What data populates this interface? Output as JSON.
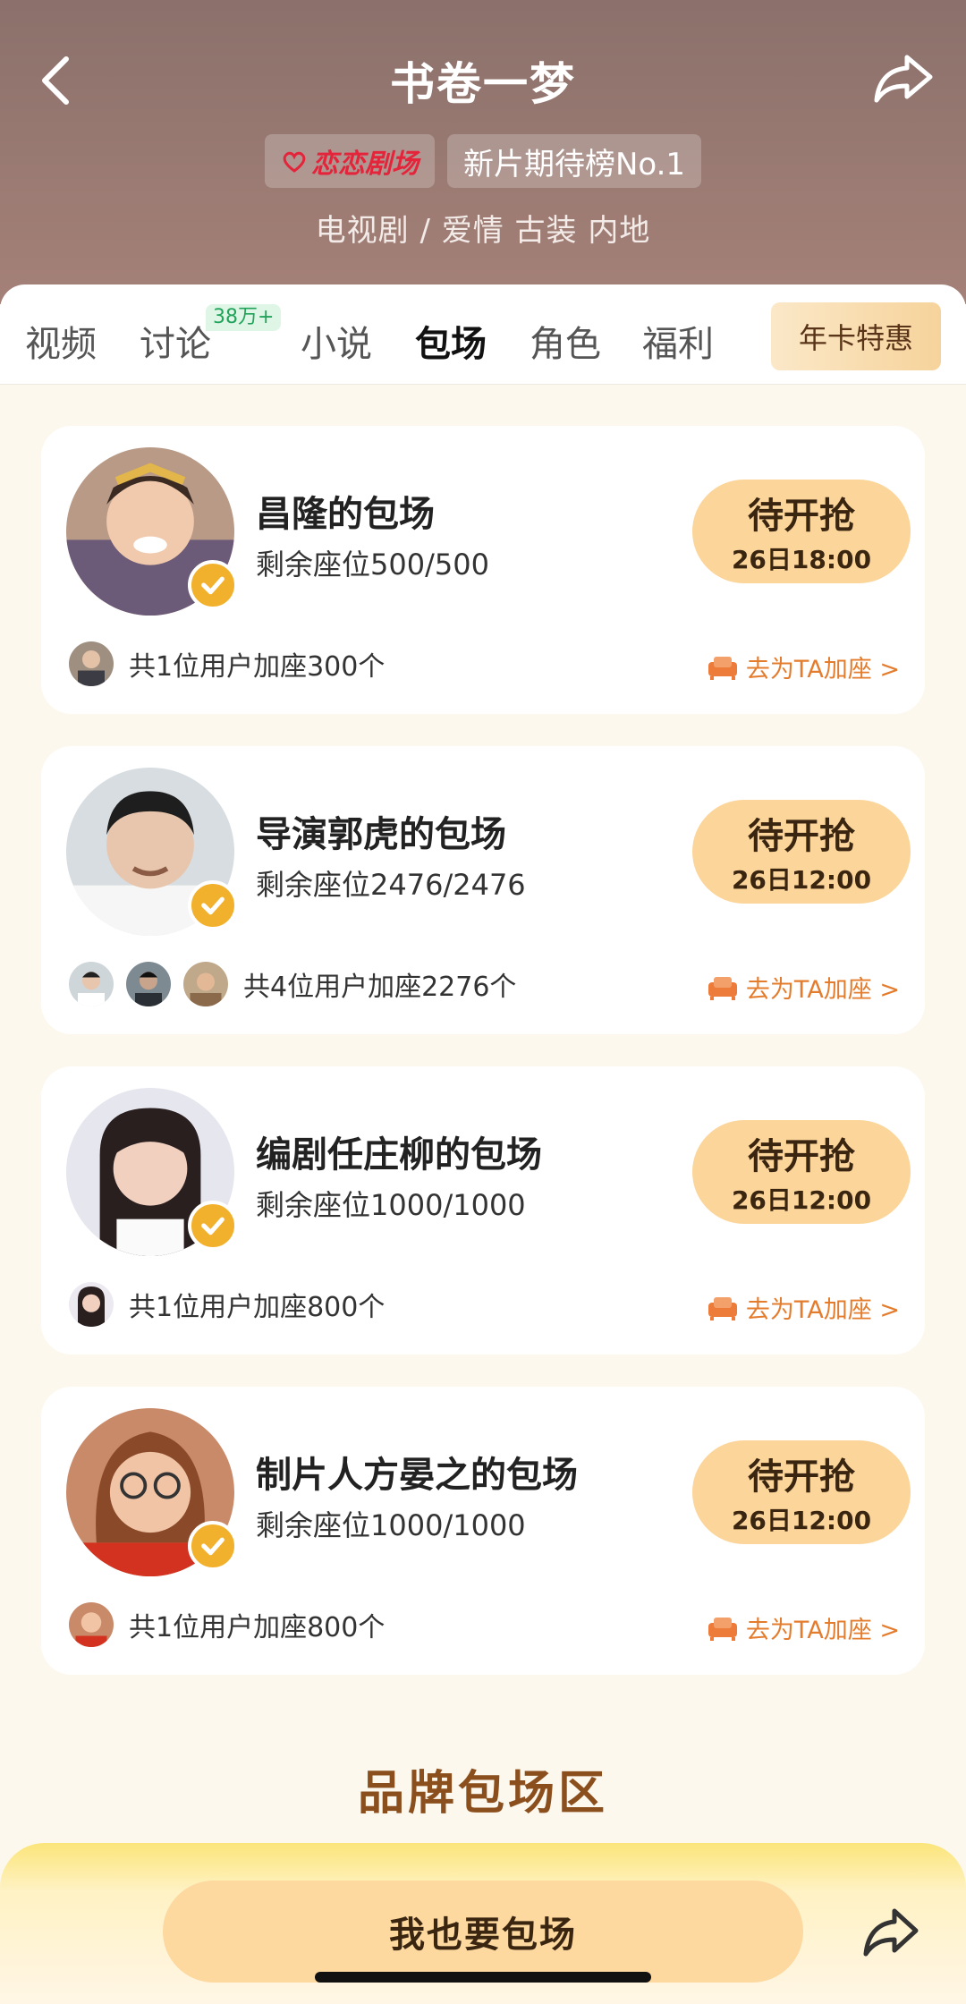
{
  "header": {
    "title": "书卷一梦",
    "brand_badge": "恋恋剧场",
    "rank_badge": "新片期待榜No.1",
    "genre": "电视剧 / 爱情 古装 内地"
  },
  "tabs": {
    "items": [
      "视频",
      "讨论",
      "小说",
      "包场",
      "角色",
      "福利"
    ],
    "active": "包场",
    "discussion_count": "38万+",
    "promo": "年卡特惠"
  },
  "cards": [
    {
      "title": "昌隆的包场",
      "seats": "剩余座位500/500",
      "button": "待开抢",
      "time": "26日18:00",
      "footer": "共1位用户加座300个",
      "link": "去为TA加座 >"
    },
    {
      "title": "导演郭虎的包场",
      "seats": "剩余座位2476/2476",
      "button": "待开抢",
      "time": "26日12:00",
      "footer": "共4位用户加座2276个",
      "link": "去为TA加座 >"
    },
    {
      "title": "编剧任庄柳的包场",
      "seats": "剩余座位1000/1000",
      "button": "待开抢",
      "time": "26日12:00",
      "footer": "共1位用户加座800个",
      "link": "去为TA加座 >"
    },
    {
      "title": "制片人方晏之的包场",
      "seats": "剩余座位1000/1000",
      "button": "待开抢",
      "time": "26日12:00",
      "footer": "共1位用户加座800个",
      "link": "去为TA加座 >"
    }
  ],
  "brand_section": {
    "title": "品牌包场区"
  },
  "cta": {
    "label": "我也要包场"
  },
  "colors": {
    "header_bg": "#9b7b73",
    "button_bg": "#fcd59b",
    "accent_orange": "#e47c2e",
    "verified_gold": "#f2b12c",
    "brand_title": "#8b4f1e"
  },
  "icons": {
    "back": "chevron-left-icon",
    "share": "share-arrow-icon",
    "verified": "verified-check-icon",
    "seat": "sofa-seat-icon"
  }
}
